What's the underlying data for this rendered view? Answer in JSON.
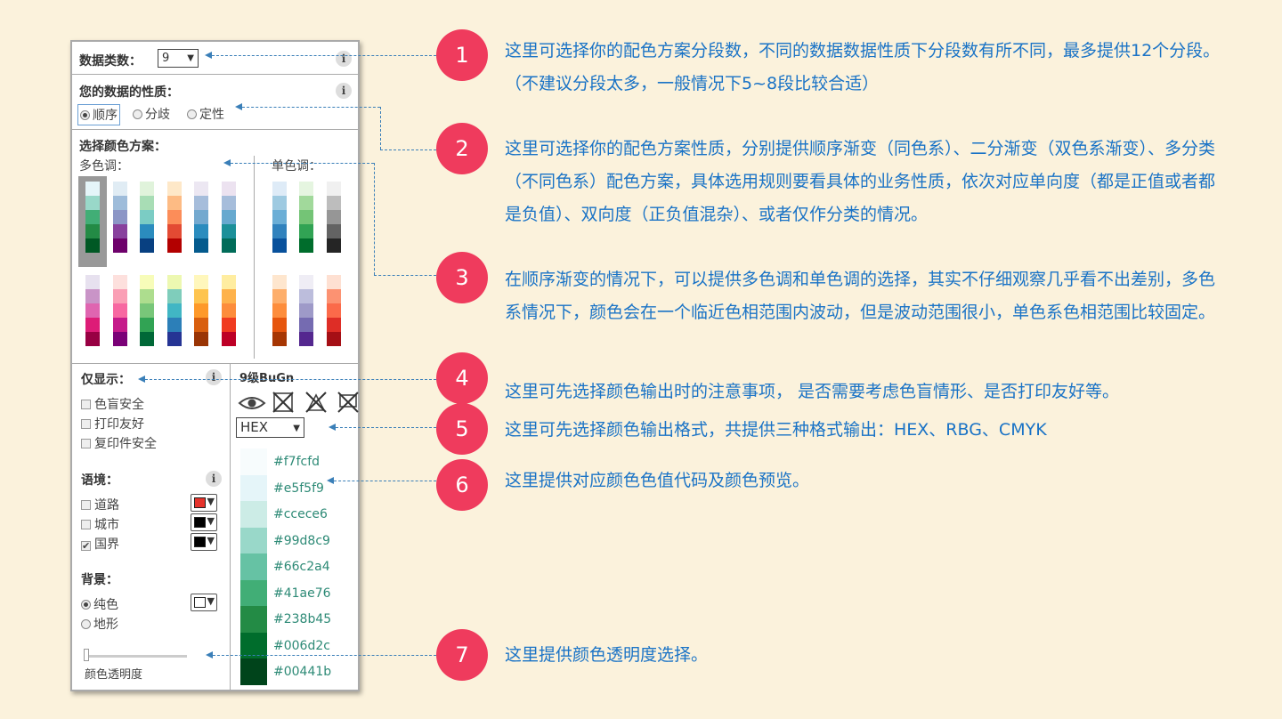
{
  "panel": {
    "classes_label": "数据类数：",
    "classes_value": "9",
    "nature_label": "您的数据的性质：",
    "nature_options": [
      "顺序",
      "分歧",
      "定性"
    ],
    "scheme_label": "选择颜色方案：",
    "multi_hue_label": "多色调：",
    "single_hue_label": "单色调：",
    "only_show_label": "仅显示：",
    "only_show_options": [
      "色盲安全",
      "打印友好",
      "复印件安全"
    ],
    "scheme_name": "9级BuGn",
    "format_value": "HEX",
    "context_label": "语境：",
    "context_options": [
      "道路",
      "城市",
      "国界"
    ],
    "background_label": "背景：",
    "background_options": [
      "纯色",
      "地形"
    ],
    "opacity_label": "颜色透明度",
    "info_glyph": "i",
    "hex_colors": [
      "#f7fcfd",
      "#e5f5f9",
      "#ccece6",
      "#99d8c9",
      "#66c2a4",
      "#41ae76",
      "#238b45",
      "#006d2c",
      "#00441b"
    ],
    "road_color": "#e5322b",
    "city_color": "#000000",
    "border_color": "#000000"
  },
  "palettes": {
    "multi_row1": [
      [
        "#e5f5f9",
        "#99d8c9",
        "#41ae76",
        "#238b45",
        "#005824"
      ],
      [
        "#e0ecf4",
        "#9ebcda",
        "#8c96c6",
        "#88419d",
        "#6e016b"
      ],
      [
        "#e0f3db",
        "#a8ddb5",
        "#7bccc4",
        "#2b8cbe",
        "#084081"
      ],
      [
        "#fee8c8",
        "#fdbb84",
        "#fc8d59",
        "#e34a33",
        "#b30000"
      ],
      [
        "#ece7f2",
        "#a6bddb",
        "#74a9cf",
        "#2b8cbe",
        "#045a8d"
      ],
      [
        "#ece2f0",
        "#a6bddb",
        "#67a9cf",
        "#1c9099",
        "#016c59"
      ]
    ],
    "multi_row2": [
      [
        "#e7e1ef",
        "#c994c7",
        "#df65b0",
        "#dd1c77",
        "#980043"
      ],
      [
        "#fde0dd",
        "#fa9fb5",
        "#f768a1",
        "#c51b8a",
        "#7a0177"
      ],
      [
        "#f7fcb9",
        "#addd8e",
        "#78c679",
        "#31a354",
        "#006837"
      ],
      [
        "#edf8b1",
        "#7fcdbb",
        "#41b6c4",
        "#2c7fb8",
        "#253494"
      ],
      [
        "#fff7bc",
        "#fec44f",
        "#fe9929",
        "#d95f0e",
        "#993404"
      ],
      [
        "#ffeda0",
        "#feb24c",
        "#fd8d3c",
        "#f03b20",
        "#bd0026"
      ]
    ],
    "single_row1": [
      [
        "#deebf7",
        "#9ecae1",
        "#6baed6",
        "#3182bd",
        "#08519c"
      ],
      [
        "#e5f5e0",
        "#a1d99b",
        "#74c476",
        "#31a354",
        "#006d2c"
      ],
      [
        "#f0f0f0",
        "#bdbdbd",
        "#969696",
        "#636363",
        "#252525"
      ]
    ],
    "single_row2": [
      [
        "#fee6ce",
        "#fdae6b",
        "#fd8d3c",
        "#e6550d",
        "#a63603"
      ],
      [
        "#efedf5",
        "#bcbddc",
        "#9e9ac8",
        "#756bb1",
        "#54278f"
      ],
      [
        "#fee0d2",
        "#fc9272",
        "#fb6a4a",
        "#de2d26",
        "#a50f15"
      ]
    ]
  },
  "annotations": [
    {
      "num": "1",
      "text": "这里可选择你的配色方案分段数，不同的数据数据性质下分段数有所不同，最多提供12个分段。（不建议分段太多，一般情况下5~8段比较合适）"
    },
    {
      "num": "2",
      "text": "这里可选择你的配色方案性质，分别提供顺序渐变（同色系）、二分渐变（双色系渐变）、多分类（不同色系）配色方案，具体选用规则要看具体的业务性质，依次对应单向度（都是正值或者都是负值）、双向度（正负值混杂）、或者仅作分类的情况。"
    },
    {
      "num": "3",
      "text": "在顺序渐变的情况下，可以提供多色调和单色调的选择，其实不仔细观察几乎看不出差别，多色系情况下，颜色会在一个临近色相范围内波动，但是波动范围很小，单色系色相范围比较固定。"
    },
    {
      "num": "4",
      "text": "这里可先选择颜色输出时的注意事项， 是否需要考虑色盲情形、是否打印友好等。"
    },
    {
      "num": "5",
      "text": "这里可先选择颜色输出格式，共提供三种格式输出：HEX、RBG、CMYK"
    },
    {
      "num": "6",
      "text": "这里提供对应颜色色值代码及颜色预览。"
    },
    {
      "num": "7",
      "text": "这里提供颜色透明度选择。"
    }
  ]
}
